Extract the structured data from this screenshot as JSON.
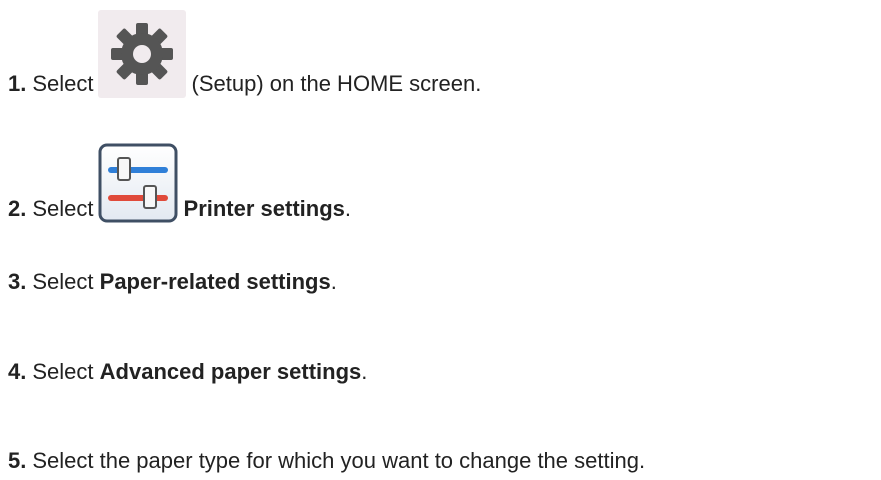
{
  "steps": [
    {
      "num": "1.",
      "before": "Select",
      "after": "(Setup) on the HOME screen.",
      "icon": "gear-icon"
    },
    {
      "num": "2.",
      "before": "Select",
      "bold": "Printer settings",
      "after": ".",
      "icon": "printer-settings-icon"
    },
    {
      "num": "3.",
      "before": "Select",
      "bold": "Paper-related settings",
      "after": "."
    },
    {
      "num": "4.",
      "before": "Select",
      "bold": "Advanced paper settings",
      "after": "."
    },
    {
      "num": "5.",
      "before": "Select the paper type for which you want to change the setting."
    }
  ],
  "colors": {
    "text": "#222222",
    "gear": "#555555",
    "gear_bg": "#f1ebee",
    "slider_blue": "#2f7fd8",
    "slider_red": "#e04a3a"
  }
}
